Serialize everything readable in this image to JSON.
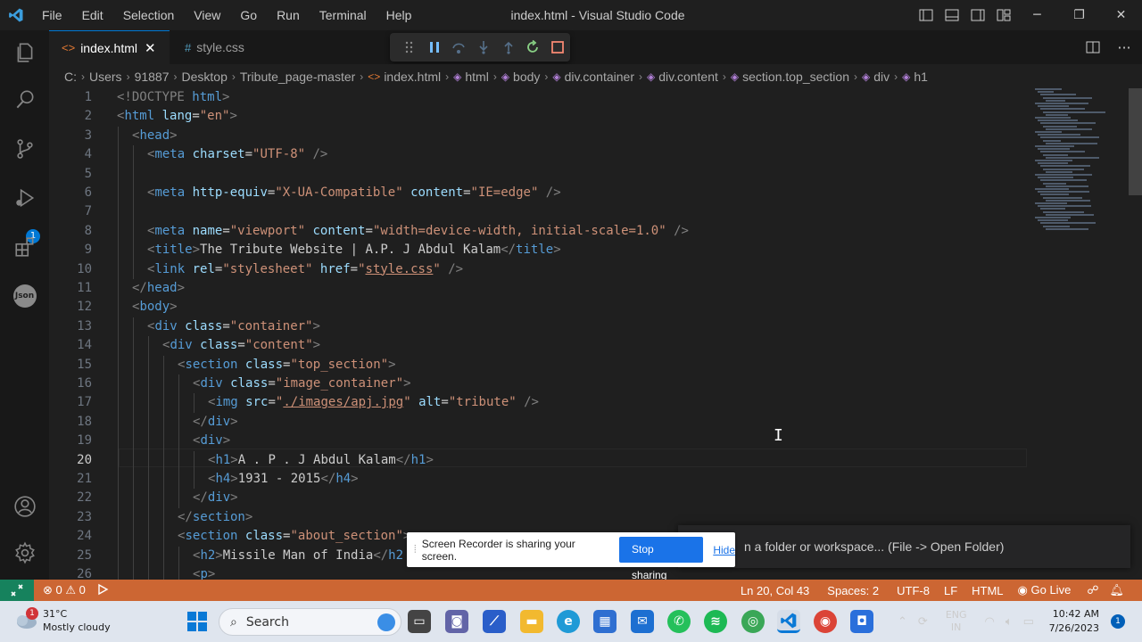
{
  "titlebar": {
    "menu": [
      "File",
      "Edit",
      "Selection",
      "View",
      "Go",
      "Run",
      "Terminal",
      "Help"
    ],
    "title": "index.html - Visual Studio Code"
  },
  "activity_bar": {
    "items": [
      "explorer-icon",
      "search-icon",
      "source-control-icon",
      "run-debug-icon",
      "extensions-icon",
      "json-icon"
    ],
    "debug_badge": "1",
    "json_label": "Json",
    "bottom": [
      "accounts-icon",
      "settings-gear-icon"
    ]
  },
  "tabs": [
    {
      "icon": "<>",
      "label": "index.html",
      "active": true,
      "close": "✕"
    },
    {
      "icon": "#",
      "label": "style.css",
      "active": false
    }
  ],
  "breadcrumb": [
    "C:",
    "Users",
    "91887",
    "Desktop",
    "Tribute_page-master",
    "index.html",
    "html",
    "body",
    "div.container",
    "div.content",
    "section.top_section",
    "div",
    "h1"
  ],
  "editor": {
    "current_line": 20,
    "lines": [
      {
        "n": "1",
        "indent": 0
      },
      {
        "n": "2",
        "indent": 0
      },
      {
        "n": "3",
        "indent": 1
      },
      {
        "n": "4",
        "indent": 2
      },
      {
        "n": "5",
        "indent": 2
      },
      {
        "n": "6",
        "indent": 2
      },
      {
        "n": "7",
        "indent": 2
      },
      {
        "n": "8",
        "indent": 2
      },
      {
        "n": "9",
        "indent": 2
      },
      {
        "n": "10",
        "indent": 2
      },
      {
        "n": "11",
        "indent": 1
      },
      {
        "n": "12",
        "indent": 1
      },
      {
        "n": "13",
        "indent": 2
      },
      {
        "n": "14",
        "indent": 3
      },
      {
        "n": "15",
        "indent": 4
      },
      {
        "n": "16",
        "indent": 5
      },
      {
        "n": "17",
        "indent": 6
      },
      {
        "n": "18",
        "indent": 5
      },
      {
        "n": "19",
        "indent": 5
      },
      {
        "n": "20",
        "indent": 6
      },
      {
        "n": "21",
        "indent": 6
      },
      {
        "n": "22",
        "indent": 5
      },
      {
        "n": "23",
        "indent": 4
      },
      {
        "n": "24",
        "indent": 4
      },
      {
        "n": "25",
        "indent": 5
      },
      {
        "n": "26",
        "indent": 5
      }
    ],
    "code": {
      "l1": [
        "<!DOCTYPE ",
        "html",
        ">"
      ],
      "l2": [
        "<",
        "html",
        " ",
        "lang",
        "=",
        "\"en\"",
        ">"
      ],
      "l3": [
        "<",
        "head",
        ">"
      ],
      "l4": [
        "<",
        "meta",
        " ",
        "charset",
        "=",
        "\"UTF-8\"",
        " />"
      ],
      "l6": [
        "<",
        "meta",
        " ",
        "http-equiv",
        "=",
        "\"X-UA-Compatible\"",
        " ",
        "content",
        "=",
        "\"IE=edge\"",
        " />"
      ],
      "l8": [
        "<",
        "meta",
        " ",
        "name",
        "=",
        "\"viewport\"",
        " ",
        "content",
        "=",
        "\"width=device-width, initial-scale=1.0\"",
        " />"
      ],
      "l9": [
        "<",
        "title",
        ">",
        "The Tribute Website | A.P. J Abdul Kalam",
        "</",
        "title",
        ">"
      ],
      "l10": [
        "<",
        "link",
        " ",
        "rel",
        "=",
        "\"stylesheet\"",
        " ",
        "href",
        "=",
        "\"",
        "style.css",
        "\"",
        " />"
      ],
      "l11": [
        "</",
        "head",
        ">"
      ],
      "l12": [
        "<",
        "body",
        ">"
      ],
      "l13": [
        "<",
        "div",
        " ",
        "class",
        "=",
        "\"container\"",
        ">"
      ],
      "l14": [
        "<",
        "div",
        " ",
        "class",
        "=",
        "\"content\"",
        ">"
      ],
      "l15": [
        "<",
        "section",
        " ",
        "class",
        "=",
        "\"top_section\"",
        ">"
      ],
      "l16": [
        "<",
        "div",
        " ",
        "class",
        "=",
        "\"image_container\"",
        ">"
      ],
      "l17": [
        "<",
        "img",
        " ",
        "src",
        "=",
        "\"",
        "./images/apj.jpg",
        "\"",
        " ",
        "alt",
        "=",
        "\"tribute\"",
        " />"
      ],
      "l18": [
        "</",
        "div",
        ">"
      ],
      "l19": [
        "<",
        "div",
        ">"
      ],
      "l20": [
        "<",
        "h1",
        ">",
        "A . P . J Abdul Kalam",
        "</",
        "h1",
        ">"
      ],
      "l21": [
        "<",
        "h4",
        ">",
        "1931 - 2015",
        "</",
        "h4",
        ">"
      ],
      "l22": [
        "</",
        "div",
        ">"
      ],
      "l23": [
        "</",
        "section",
        ">"
      ],
      "l24": [
        "<",
        "section",
        " ",
        "class",
        "=",
        "\"about_section\"",
        ">"
      ],
      "l25": [
        "<",
        "h2",
        ">",
        "Missile Man of India",
        "</",
        "h2"
      ],
      "l26": [
        "<",
        "p",
        ">"
      ]
    }
  },
  "notification": {
    "text": "n a folder or workspace... (File -> Open Folder)"
  },
  "screen_recorder": {
    "message": "Screen Recorder is sharing your screen.",
    "stop_label": "Stop sharing",
    "hide_label": "Hide"
  },
  "statusbar": {
    "errors": "0",
    "warnings": "0",
    "position": "Ln 20, Col 43",
    "spaces": "Spaces: 2",
    "encoding": "UTF-8",
    "eol": "LF",
    "language": "HTML",
    "go_live": "Go Live",
    "colors": {
      "background": "#cc6633",
      "remote": "#16825d"
    }
  },
  "taskbar": {
    "weather_temp": "31°C",
    "weather_desc": "Mostly cloudy",
    "weather_badge": "1",
    "search_placeholder": "Search",
    "apps": [
      "file-explorer-icon",
      "teams-icon",
      "vscode-alt-icon",
      "folder-icon",
      "edge-icon",
      "store-icon",
      "mail-icon",
      "whatsapp-icon",
      "spotify-icon",
      "chrome-profile-icon",
      "vscode-icon",
      "chrome-icon",
      "screen-recorder-icon"
    ],
    "lang": "ENG",
    "region": "IN",
    "time": "10:42 AM",
    "date": "7/26/2023",
    "notif_count": "1"
  }
}
